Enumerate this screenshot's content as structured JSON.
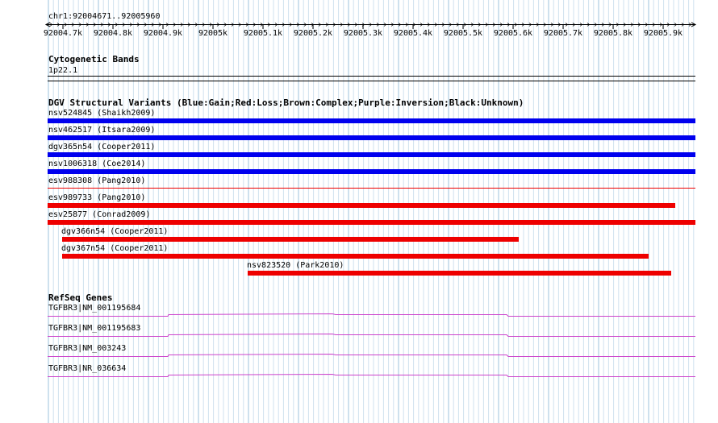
{
  "ruler": {
    "region": "chr1:92004671..92005960",
    "ticks": [
      "92004.7k",
      "92004.8k",
      "92004.9k",
      "92005k",
      "92005.1k",
      "92005.2k",
      "92005.3k",
      "92005.4k",
      "92005.5k",
      "92005.6k",
      "92005.7k",
      "92005.8k",
      "92005.9k"
    ]
  },
  "cytoband": {
    "title": "Cytogenetic Bands",
    "band": "1p22.1"
  },
  "dgv": {
    "title": "DGV Structural Variants (Blue:Gain;Red:Loss;Brown:Complex;Purple:Inversion;Black:Unknown)",
    "gain_color": "#0000ee",
    "loss_color": "#ee0000",
    "features": [
      {
        "label": "nsv524845 (Shaikh2009)",
        "type": "gain"
      },
      {
        "label": "nsv462517 (Itsara2009)",
        "type": "gain"
      },
      {
        "label": "dgv365n54 (Cooper2011)",
        "type": "gain"
      },
      {
        "label": "nsv1006318 (Coe2014)",
        "type": "gain"
      },
      {
        "label": "esv988308 (Pang2010)",
        "type": "loss"
      },
      {
        "label": "esv989733 (Pang2010)",
        "type": "loss"
      },
      {
        "label": "esv25877 (Conrad2009)",
        "type": "loss"
      },
      {
        "label": "dgv366n54 (Cooper2011)",
        "type": "loss"
      },
      {
        "label": "dgv367n54 (Cooper2011)",
        "type": "loss"
      },
      {
        "label": "nsv823520 (Park2010)",
        "type": "loss"
      }
    ]
  },
  "refseq": {
    "title": "RefSeq Genes",
    "color": "#cc44cc",
    "genes": [
      {
        "label": "TGFBR3|NM_001195684"
      },
      {
        "label": "TGFBR3|NM_001195683"
      },
      {
        "label": "TGFBR3|NM_003243"
      },
      {
        "label": "TGFBR3|NR_036634"
      }
    ]
  }
}
